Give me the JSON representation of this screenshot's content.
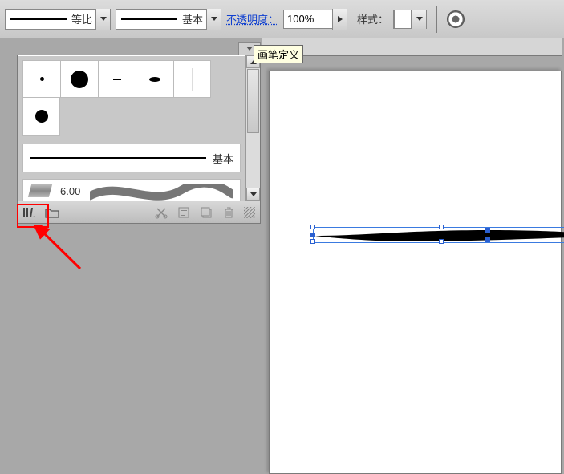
{
  "toolbar": {
    "shape_profile_label": "等比",
    "brush_profile_label": "基本",
    "opacity_label": "不透明度：",
    "opacity_value": "100%",
    "style_label": "样式：",
    "tooltip": "画笔定义"
  },
  "brush_panel": {
    "basic_brush_label": "基本",
    "brush_font_size": "6.00",
    "footer": {
      "library_menu_label": "库菜单",
      "folder_label": "文件夹"
    }
  }
}
